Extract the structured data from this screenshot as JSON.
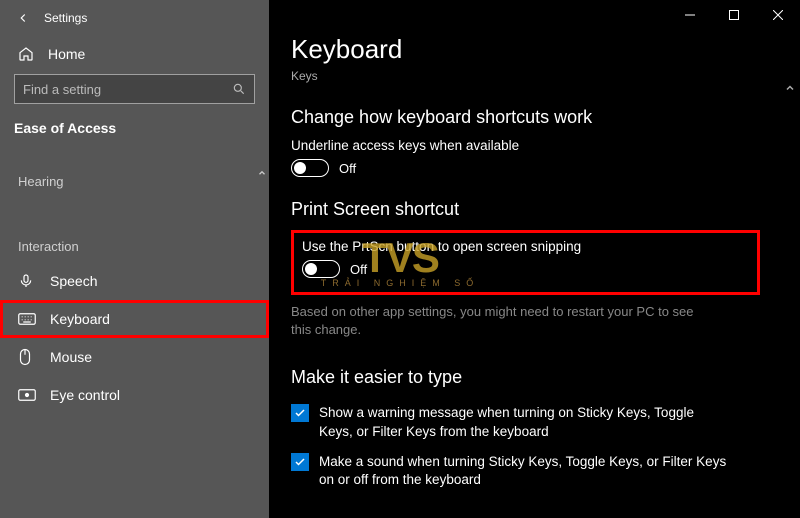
{
  "titlebar": {
    "app_name": "Settings"
  },
  "sidebar": {
    "home_label": "Home",
    "search_placeholder": "Find a setting",
    "category": "Ease of Access",
    "groups": [
      {
        "label": "Hearing",
        "items": []
      },
      {
        "label": "Interaction",
        "items": [
          {
            "id": "speech",
            "label": "Speech",
            "icon": "microphone-icon",
            "selected": false
          },
          {
            "id": "keyboard",
            "label": "Keyboard",
            "icon": "keyboard-icon",
            "selected": true
          },
          {
            "id": "mouse",
            "label": "Mouse",
            "icon": "mouse-icon",
            "selected": false
          },
          {
            "id": "eye-control",
            "label": "Eye control",
            "icon": "eye-control-icon",
            "selected": false
          }
        ]
      }
    ]
  },
  "main": {
    "title": "Keyboard",
    "subtitle": "Keys",
    "sections": {
      "shortcuts": {
        "heading": "Change how keyboard shortcuts work",
        "underline_label": "Underline access keys when available",
        "underline_state": "Off"
      },
      "printscreen": {
        "heading": "Print Screen shortcut",
        "prtscn_label": "Use the PrtScn button to open screen snipping",
        "prtscn_state": "Off",
        "desc": "Based on other app settings, you might need to restart your PC to see this change."
      },
      "easier": {
        "heading": "Make it easier to type",
        "check1": "Show a warning message when turning on Sticky Keys, Toggle Keys, or Filter Keys from the keyboard",
        "check2": "Make a sound when turning Sticky Keys, Toggle Keys, or Filter Keys on or off from the keyboard"
      }
    }
  },
  "watermark": {
    "logo": "TVS",
    "tagline": "TRẢI NGHIỆM SỐ"
  }
}
